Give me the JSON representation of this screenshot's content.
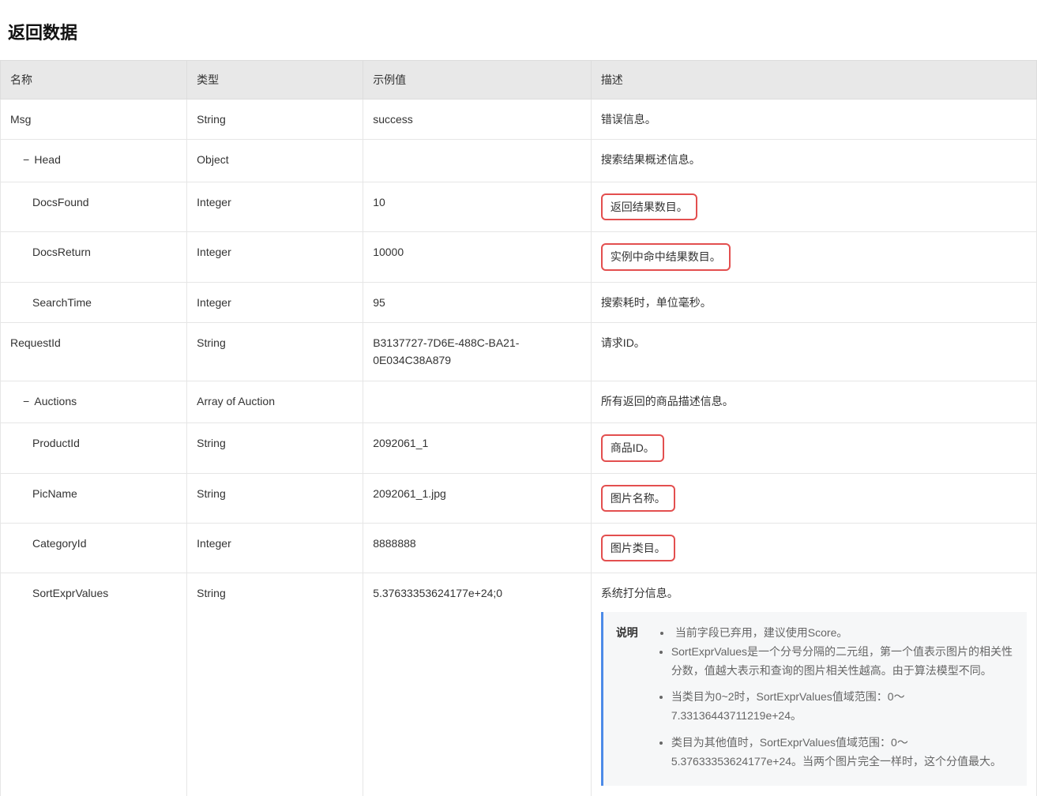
{
  "section_title": "返回数据",
  "headers": {
    "name": "名称",
    "type": "类型",
    "example": "示例值",
    "desc": "描述"
  },
  "rows": {
    "msg": {
      "name": "Msg",
      "type": "String",
      "example": "success",
      "desc": "错误信息。"
    },
    "head": {
      "name": "Head",
      "type": "Object",
      "example": "",
      "desc": "搜索结果概述信息。"
    },
    "docsfound": {
      "name": "DocsFound",
      "type": "Integer",
      "example": "10",
      "desc": "返回结果数目。"
    },
    "docsreturn": {
      "name": "DocsReturn",
      "type": "Integer",
      "example": "10000",
      "desc": "实例中命中结果数目。"
    },
    "searchtime": {
      "name": "SearchTime",
      "type": "Integer",
      "example": "95",
      "desc": "搜索耗时，单位毫秒。"
    },
    "requestid": {
      "name": "RequestId",
      "type": "String",
      "example": "B3137727-7D6E-488C-BA21-0E034C38A879",
      "desc": "请求ID。"
    },
    "auctions": {
      "name": "Auctions",
      "type": "Array of Auction",
      "example": "",
      "desc": "所有返回的商品描述信息。"
    },
    "productid": {
      "name": "ProductId",
      "type": "String",
      "example": "2092061_1",
      "desc": "商品ID。"
    },
    "picname": {
      "name": "PicName",
      "type": "String",
      "example": "2092061_1.jpg",
      "desc": "图片名称。"
    },
    "categoryid": {
      "name": "CategoryId",
      "type": "Integer",
      "example": "8888888",
      "desc": "图片类目。"
    },
    "sortexpr": {
      "name": "SortExprValues",
      "type": "String",
      "example": "5.37633353624177e+24;0",
      "desc_lead": "系统打分信息。"
    }
  },
  "note": {
    "label": "说明",
    "bullets": [
      "当前字段已弃用，建议使用Score。",
      "SortExprValues是一个分号分隔的二元组，第一个值表示图片的相关性分数，值越大表示和查询的图片相关性越高。由于算法模型不同。",
      "当类目为0~2时，SortExprValues值域范围：0～7.33136443711219e+24。",
      "类目为其他值时，SortExprValues值域范围：0～5.37633353624177e+24。当两个图片完全一样时，这个分值最大。"
    ]
  }
}
